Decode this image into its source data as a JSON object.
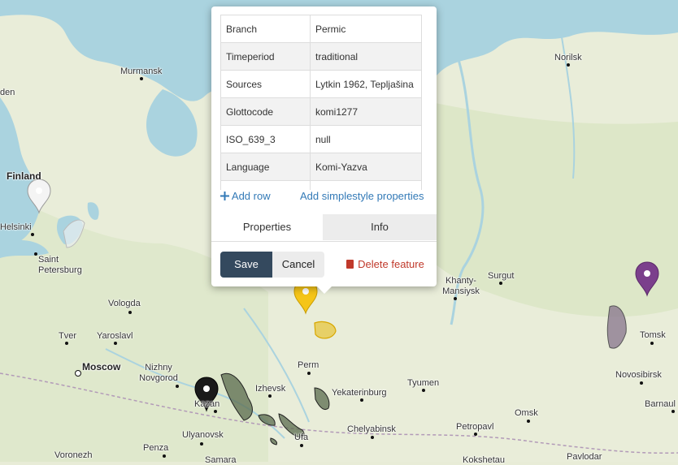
{
  "map": {
    "cities": [
      {
        "label": "Norilsk",
        "big": false
      },
      {
        "label": "Murmansk",
        "big": false
      },
      {
        "label": "Finland",
        "big": true
      },
      {
        "label": "Helsinki",
        "big": false
      },
      {
        "label": "Saint Petersburg",
        "big": false
      },
      {
        "label": "Vologda",
        "big": false
      },
      {
        "label": "Tver",
        "big": false
      },
      {
        "label": "Yaroslavl",
        "big": false
      },
      {
        "label": "Moscow",
        "big": true
      },
      {
        "label": "Nizhny Novgorod",
        "big": false
      },
      {
        "label": "Kazan",
        "big": false
      },
      {
        "label": "Izhevsk",
        "big": false
      },
      {
        "label": "Perm",
        "big": false
      },
      {
        "label": "Yekaterinburg",
        "big": false
      },
      {
        "label": "Tyumen",
        "big": false
      },
      {
        "label": "Khanty-Mansiysk",
        "big": false
      },
      {
        "label": "Surgut",
        "big": false
      },
      {
        "label": "Tomsk",
        "big": false
      },
      {
        "label": "Novosibirsk",
        "big": false
      },
      {
        "label": "Barnaul",
        "big": false
      },
      {
        "label": "Omsk",
        "big": false
      },
      {
        "label": "Petropavl",
        "big": false
      },
      {
        "label": "Chelyabinsk",
        "big": false
      },
      {
        "label": "Ulyanovsk",
        "big": false
      },
      {
        "label": "Ufa",
        "big": false
      },
      {
        "label": "Penza",
        "big": false
      },
      {
        "label": "Voronezh",
        "big": false
      },
      {
        "label": "Samara",
        "big": false
      },
      {
        "label": "Kokshetau",
        "big": false
      },
      {
        "label": "Pavlodar",
        "big": false
      },
      {
        "label": "den",
        "big": false
      }
    ],
    "marker_colors": {
      "white": "#f4f4f4",
      "yellow": "#f5c518",
      "black": "#1a1a1a",
      "purple": "#7b3f8c"
    }
  },
  "popup": {
    "properties": [
      {
        "key": "Branch",
        "value": "Permic"
      },
      {
        "key": "Timeperiod",
        "value": "traditional"
      },
      {
        "key": "Sources",
        "value": "Lytkin 1962, Tepljašina"
      },
      {
        "key": "Glottocode",
        "value": "komi1277"
      },
      {
        "key": "ISO_639_3",
        "value": "null"
      },
      {
        "key": "Language",
        "value": "Komi-Yazva"
      },
      {
        "key": "",
        "value": ""
      }
    ],
    "add_row_label": "Add row",
    "add_simplestyle_label": "Add simplestyle properties",
    "tabs": {
      "properties": "Properties",
      "info": "Info"
    },
    "save_label": "Save",
    "cancel_label": "Cancel",
    "delete_label": "Delete feature"
  }
}
